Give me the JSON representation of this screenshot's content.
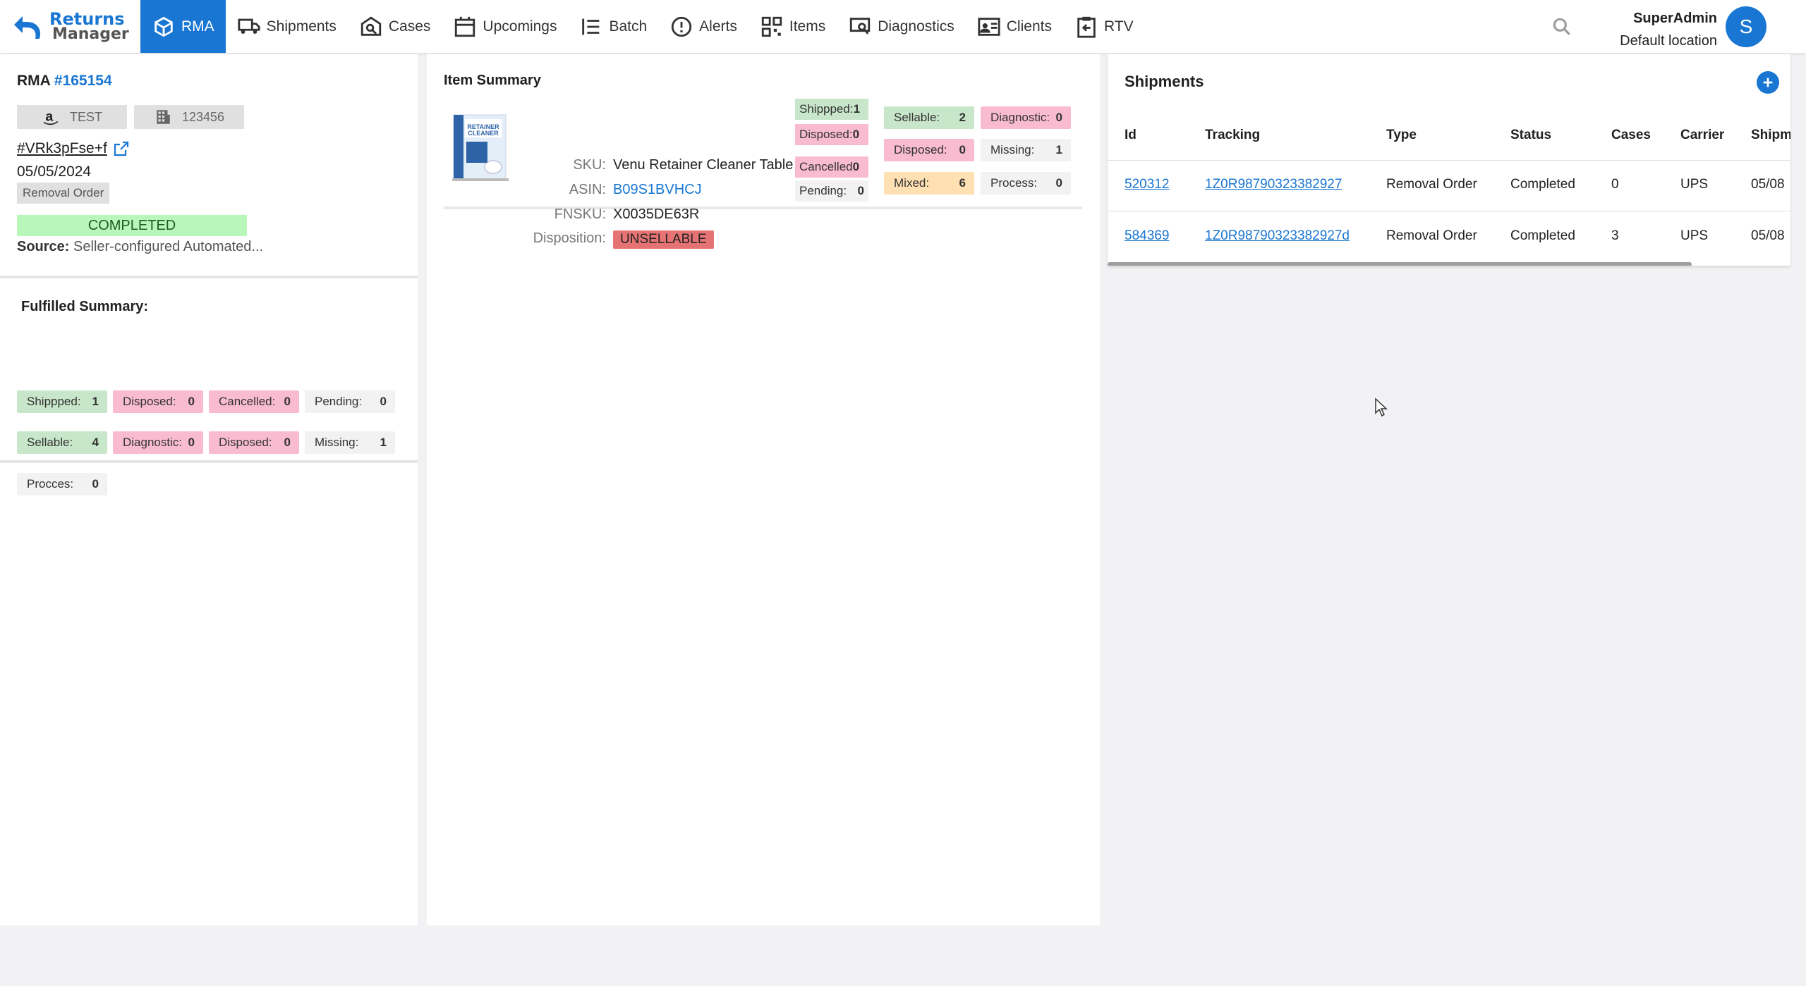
{
  "app": {
    "logo_line1": "Returns",
    "logo_line2": "Manager"
  },
  "nav": {
    "items": [
      {
        "label": "RMA",
        "icon": "cube-icon"
      },
      {
        "label": "Shipments",
        "icon": "truck-icon"
      },
      {
        "label": "Cases",
        "icon": "case-search-icon"
      },
      {
        "label": "Upcomings",
        "icon": "calendar-icon"
      },
      {
        "label": "Batch",
        "icon": "list-icon"
      },
      {
        "label": "Alerts",
        "icon": "alert-icon"
      },
      {
        "label": "Items",
        "icon": "qr-icon"
      },
      {
        "label": "Diagnostics",
        "icon": "diagnostics-icon"
      },
      {
        "label": "Clients",
        "icon": "id-card-icon"
      },
      {
        "label": "RTV",
        "icon": "clipboard-return-icon"
      }
    ]
  },
  "user": {
    "name": "SuperAdmin",
    "location": "Default location",
    "initial": "S"
  },
  "rma": {
    "label": "RMA",
    "number": "#165154",
    "store_chip": "TEST",
    "warehouse_chip": "123456",
    "reference": "#VRk3pFse+f",
    "date": "05/05/2024",
    "type": "Removal Order",
    "status": "COMPLETED",
    "source_label": "Source:",
    "source_value": "Seller-configured Automated..."
  },
  "fulfilled": {
    "title": "Fulfilled Summary:",
    "shipped": {
      "label": "Shippped:",
      "value": "1"
    },
    "disposed": {
      "label": "Disposed:",
      "value": "0"
    },
    "cancelled": {
      "label": "Cancelled:",
      "value": "0"
    },
    "pending": {
      "label": "Pending:",
      "value": "0"
    },
    "sellable": {
      "label": "Sellable:",
      "value": "4"
    },
    "diagnostic": {
      "label": "Diagnostic:",
      "value": "0"
    },
    "disposed2": {
      "label": "Disposed:",
      "value": "0"
    },
    "missing": {
      "label": "Missing:",
      "value": "1"
    },
    "procces": {
      "label": "Procces:",
      "value": "0"
    }
  },
  "item_summary": {
    "title": "Item Summary",
    "image_text": "RETAINER CLEANER",
    "sku_label": "SKU:",
    "sku": "Venu Retainer Cleaner Table",
    "asin_label": "ASIN:",
    "asin": "B09S1BVHCJ",
    "fnsku_label": "FNSKU:",
    "fnsku": "X0035DE63R",
    "disposition_label": "Disposition:",
    "disposition": "UNSELLABLE",
    "shipped": {
      "label": "Shippped:",
      "value": "1"
    },
    "disposed": {
      "label": "Disposed:",
      "value": "0"
    },
    "cancelled": {
      "label": "Cancelled",
      "value": "0"
    },
    "pending": {
      "label": "Pending:",
      "value": "0"
    },
    "sellable": {
      "label": "Sellable:",
      "value": "2"
    },
    "diagnostic": {
      "label": "Diagnostic:",
      "value": "0"
    },
    "disposed2": {
      "label": "Disposed:",
      "value": "0"
    },
    "missing": {
      "label": "Missing:",
      "value": "1"
    },
    "mixed": {
      "label": "Mixed:",
      "value": "6"
    },
    "process": {
      "label": "Process:",
      "value": "0"
    }
  },
  "shipments": {
    "title": "Shipments",
    "columns": [
      "Id",
      "Tracking",
      "Type",
      "Status",
      "Cases",
      "Carrier",
      "Shipm"
    ],
    "rows": [
      {
        "id": "520312",
        "tracking": "1Z0R98790323382927",
        "type": "Removal Order",
        "status": "Completed",
        "cases": "0",
        "carrier": "UPS",
        "shipped": "05/08"
      },
      {
        "id": "584369",
        "tracking": "1Z0R98790323382927d",
        "type": "Removal Order",
        "status": "Completed",
        "cases": "3",
        "carrier": "UPS",
        "shipped": "05/08"
      }
    ]
  },
  "colors": {
    "primary": "#1976d2",
    "completed": "#b9f6ba",
    "unsellable": "#e57373"
  }
}
